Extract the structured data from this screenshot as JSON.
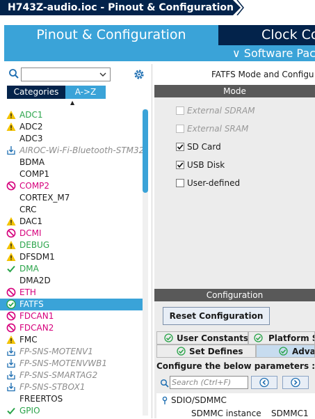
{
  "title": {
    "text": "H743Z-audio.ioc - Pinout & Configuration"
  },
  "tabs": {
    "main": "Pinout & Configuration",
    "clock": "Clock Co",
    "software": "∨ Software Pac"
  },
  "left": {
    "categories_tab": "Categories",
    "az_tab": "A->Z",
    "sort_caret": "▲",
    "items": [
      {
        "label": "ADC1",
        "icon": "warning-icon",
        "color": "green"
      },
      {
        "label": "ADC2",
        "icon": "warning-icon",
        "color": "dark"
      },
      {
        "label": "ADC3",
        "icon": "none",
        "color": "dark"
      },
      {
        "label": "AIROC-Wi-Fi-Bluetooth-STM32",
        "icon": "download-icon",
        "color": "grey"
      },
      {
        "label": "BDMA",
        "icon": "none",
        "color": "dark"
      },
      {
        "label": "COMP1",
        "icon": "none",
        "color": "dark"
      },
      {
        "label": "COMP2",
        "icon": "forbidden-icon",
        "color": "magenta"
      },
      {
        "label": "CORTEX_M7",
        "icon": "none",
        "color": "dark"
      },
      {
        "label": "CRC",
        "icon": "none",
        "color": "dark"
      },
      {
        "label": "DAC1",
        "icon": "warning-icon",
        "color": "dark"
      },
      {
        "label": "DCMI",
        "icon": "forbidden-icon",
        "color": "magenta"
      },
      {
        "label": "DEBUG",
        "icon": "warning-icon",
        "color": "green"
      },
      {
        "label": "DFSDM1",
        "icon": "warning-icon",
        "color": "dark"
      },
      {
        "label": "DMA",
        "icon": "check-icon",
        "color": "green"
      },
      {
        "label": "DMA2D",
        "icon": "none",
        "color": "dark"
      },
      {
        "label": "ETH",
        "icon": "forbidden-icon",
        "color": "magenta"
      },
      {
        "label": "FATFS",
        "icon": "check-circle-icon",
        "color": "selected"
      },
      {
        "label": "FDCAN1",
        "icon": "forbidden-icon",
        "color": "magenta"
      },
      {
        "label": "FDCAN2",
        "icon": "forbidden-icon",
        "color": "magenta"
      },
      {
        "label": "FMC",
        "icon": "warning-icon",
        "color": "dark"
      },
      {
        "label": "FP-SNS-MOTENV1",
        "icon": "download-icon",
        "color": "grey"
      },
      {
        "label": "FP-SNS-MOTENVWB1",
        "icon": "download-icon",
        "color": "grey"
      },
      {
        "label": "FP-SNS-SMARTAG2",
        "icon": "download-icon",
        "color": "grey"
      },
      {
        "label": "FP-SNS-STBOX1",
        "icon": "download-icon",
        "color": "grey"
      },
      {
        "label": "FREERTOS",
        "icon": "none",
        "color": "dark"
      },
      {
        "label": "GPIO",
        "icon": "check-icon",
        "color": "green"
      }
    ]
  },
  "right": {
    "mode_title": "FATFS Mode and Configu",
    "mode_bar": "Mode",
    "mode_options": [
      {
        "label": "External SDRAM",
        "checked": false,
        "enabled": false
      },
      {
        "label": "External SRAM",
        "checked": false,
        "enabled": false
      },
      {
        "label": "SD Card",
        "checked": true,
        "enabled": true
      },
      {
        "label": "USB Disk",
        "checked": true,
        "enabled": true
      },
      {
        "label": "User-defined",
        "checked": false,
        "enabled": true
      }
    ],
    "config_bar": "Configuration",
    "reset_button": "Reset Configuration",
    "sub_tabs": {
      "user_constants": "User Constants",
      "platform_settings": "Platform Se",
      "set_defines": "Set Defines",
      "advanced": "Advan"
    },
    "params_label": "Configure the below parameters :",
    "search_placeholder": "Search (Ctrl+F)",
    "tree_group": "SDIO/SDMMC",
    "tree_row_label": "SDMMC instance",
    "tree_row_value": "SDMMC1"
  },
  "colors": {
    "navy": "#03234b",
    "blue": "#3aa3d8",
    "green": "#2aa44a",
    "magenta": "#d6007c",
    "warning": "#f2c200",
    "bar_grey": "#595959"
  }
}
